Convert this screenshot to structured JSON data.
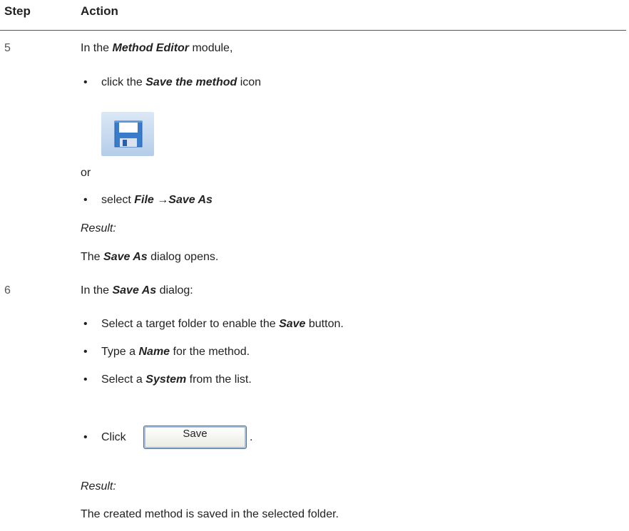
{
  "table": {
    "col_step": "Step",
    "col_action": "Action"
  },
  "step5": {
    "number": "5",
    "intro": [
      "In the ",
      "Method Editor",
      " module,"
    ],
    "bullet1": [
      "click the ",
      "Save the method",
      " icon"
    ],
    "icon": "save-floppy-icon",
    "or": "or",
    "bullet2": [
      "select ",
      "File",
      " →",
      "Save As"
    ],
    "result_label": "Result:",
    "result_text": [
      "The ",
      "Save As",
      " dialog opens."
    ]
  },
  "step6": {
    "number": "6",
    "intro": [
      "In the ",
      "Save As",
      " dialog:"
    ],
    "bullet1": [
      "Select a target folder to enable the ",
      "Save",
      " button."
    ],
    "bullet2": [
      "Type a ",
      "Name",
      " for the method."
    ],
    "bullet3": [
      "Select a ",
      "System",
      " from the list."
    ],
    "bullet4": [
      "Click ",
      "."
    ],
    "button_label": "Save",
    "result_label": "Result:",
    "result_text": "The created method is saved in the selected folder."
  },
  "bullet_char": "•",
  "colors": {
    "icon_frame": "#3a7ccc",
    "button_border": "#5f6f8a"
  }
}
